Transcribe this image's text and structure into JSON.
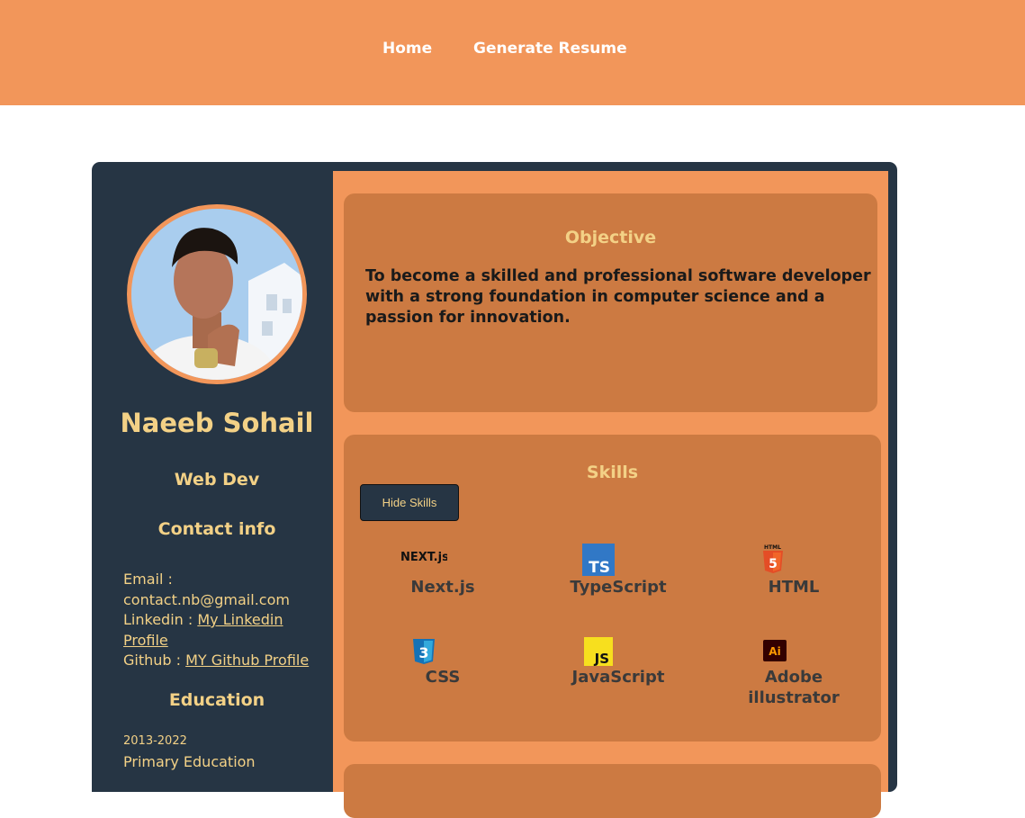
{
  "nav": {
    "home": "Home",
    "generate": "Generate Resume"
  },
  "profile": {
    "name": "Naeeb Sohail",
    "role": "Web Dev",
    "contact_heading": "Contact info",
    "email_label": "Email :",
    "email": "contact.nb@gmail.com",
    "linkedin_label": "Linkedin :",
    "linkedin_link_1": "My Linkedin",
    "linkedin_link_2": "Profile",
    "github_label": "Github :",
    "github_link": "MY Github Profile",
    "education_heading": "Education",
    "education_years": "2013-2022",
    "education_title": "Primary Education"
  },
  "objective": {
    "title": "Objective",
    "text": "To become a skilled and professional software developer with a strong foundation in computer science and a passion for innovation."
  },
  "skills": {
    "title": "Skills",
    "toggle_label": "Hide Skills",
    "items": [
      {
        "label": "Next.js",
        "icon": "nextjs-icon",
        "icon_text": "NEXT.js"
      },
      {
        "label": "TypeScript",
        "icon": "typescript-icon",
        "icon_text": "TS"
      },
      {
        "label": "HTML",
        "icon": "html5-icon",
        "icon_text": "5"
      },
      {
        "label": "CSS",
        "icon": "css3-icon",
        "icon_text": "3"
      },
      {
        "label": "JavaScript",
        "icon": "javascript-icon",
        "icon_text": "JS"
      },
      {
        "label": "Adobe illustrator",
        "icon": "adobe-illustrator-icon",
        "icon_text": "Ai"
      }
    ]
  },
  "colors": {
    "accent_orange": "#f2965a",
    "panel_orange": "#cc7a42",
    "sidebar_navy": "#263544",
    "gold_text": "#f3d186"
  }
}
